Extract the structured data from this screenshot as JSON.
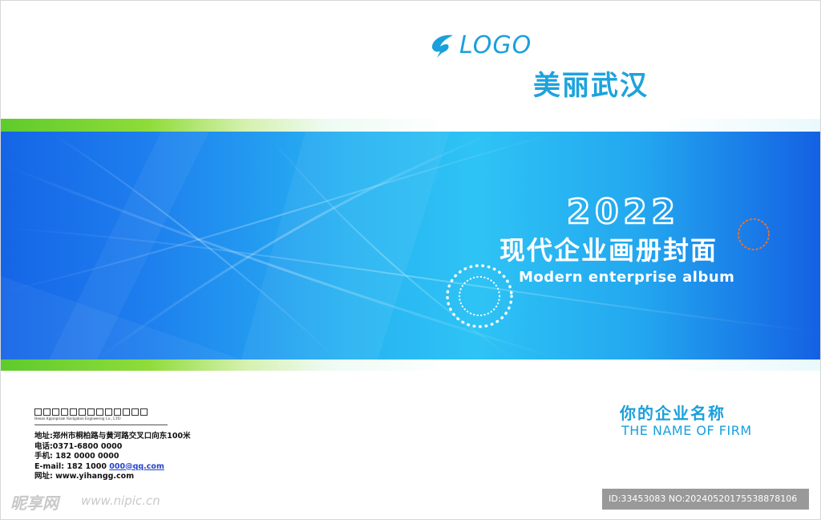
{
  "header": {
    "logo_text": "LOGO",
    "city_title": "美丽武汉"
  },
  "band": {
    "year": "2022",
    "title": "现代企业画册封面",
    "subtitle": "Modern enterprise album"
  },
  "firm": {
    "name_cn": "你的企业名称",
    "name_en": "THE NAME OF FIRM"
  },
  "contact": {
    "company_en": "Henan Appropriate Navigation Engineering Co., LTD",
    "address": "地址:郑州市桐柏路与黄河路交叉口向东100米",
    "phone": "电话:0371-6800 0000",
    "mobile": "手机: 182 0000 0000",
    "email_prefix": "E-mail: 182 1000 ",
    "email_link": "000@qq.com",
    "website": "网址: www.yihangg.com"
  },
  "watermark": {
    "site_name": "昵享网",
    "site_url": "www.nipic.cn",
    "id_text": "ID:33453083 NO:20240520175538878106"
  },
  "colors": {
    "accent": "#1aa0dc",
    "band_dark": "#1460e3",
    "band_light": "#2ec3f5",
    "stripe_green": "#5ecb2c",
    "ring_orange": "#e8732a"
  },
  "icons": [
    "logo-mark-icon",
    "dotted-ring-icon"
  ]
}
